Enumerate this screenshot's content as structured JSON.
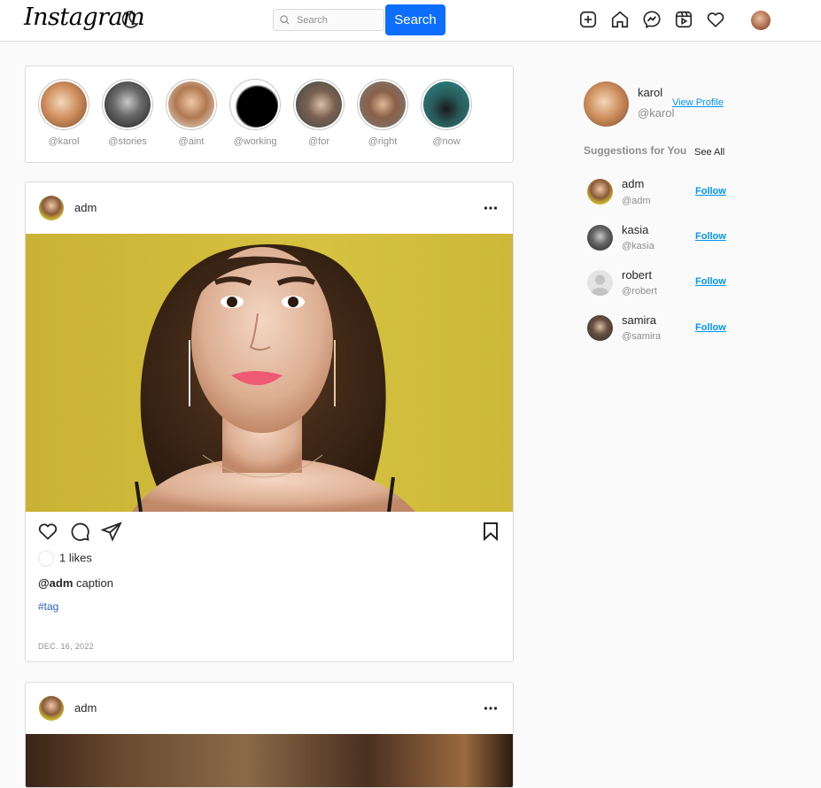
{
  "app": {
    "logo": "Instagram"
  },
  "search": {
    "placeholder": "Search",
    "button_label": "Search"
  },
  "stories": [
    {
      "handle": "@karol"
    },
    {
      "handle": "@stories"
    },
    {
      "handle": "@aint"
    },
    {
      "handle": "@working"
    },
    {
      "handle": "@for"
    },
    {
      "handle": "@right"
    },
    {
      "handle": "@now"
    }
  ],
  "posts": [
    {
      "user": "adm",
      "likes": "1 likes",
      "caption_user": "@adm",
      "caption_text": " caption",
      "tag": "#tag",
      "date": "DEC. 16, 2022"
    },
    {
      "user": "adm"
    }
  ],
  "profile": {
    "name": "karol",
    "handle": "@karol",
    "view_profile": "View Profile"
  },
  "suggestions": {
    "title": "Suggestions for You",
    "see_all": "See All",
    "follow_label": "Follow",
    "items": [
      {
        "name": "adm",
        "handle": "@adm"
      },
      {
        "name": "kasia",
        "handle": "@kasia"
      },
      {
        "name": "robert",
        "handle": "@robert"
      },
      {
        "name": "samira",
        "handle": "@samira"
      }
    ]
  },
  "colors": {
    "accent": "#0d6efd",
    "link": "#0095f6",
    "tag": "#2f63c4",
    "border": "#dbdbdb"
  },
  "icons": [
    "moon-icon",
    "search-icon",
    "new-post-icon",
    "home-icon",
    "messenger-icon",
    "reels-icon",
    "heart-icon",
    "more-icon",
    "like-icon",
    "comment-icon",
    "share-icon",
    "bookmark-icon"
  ]
}
